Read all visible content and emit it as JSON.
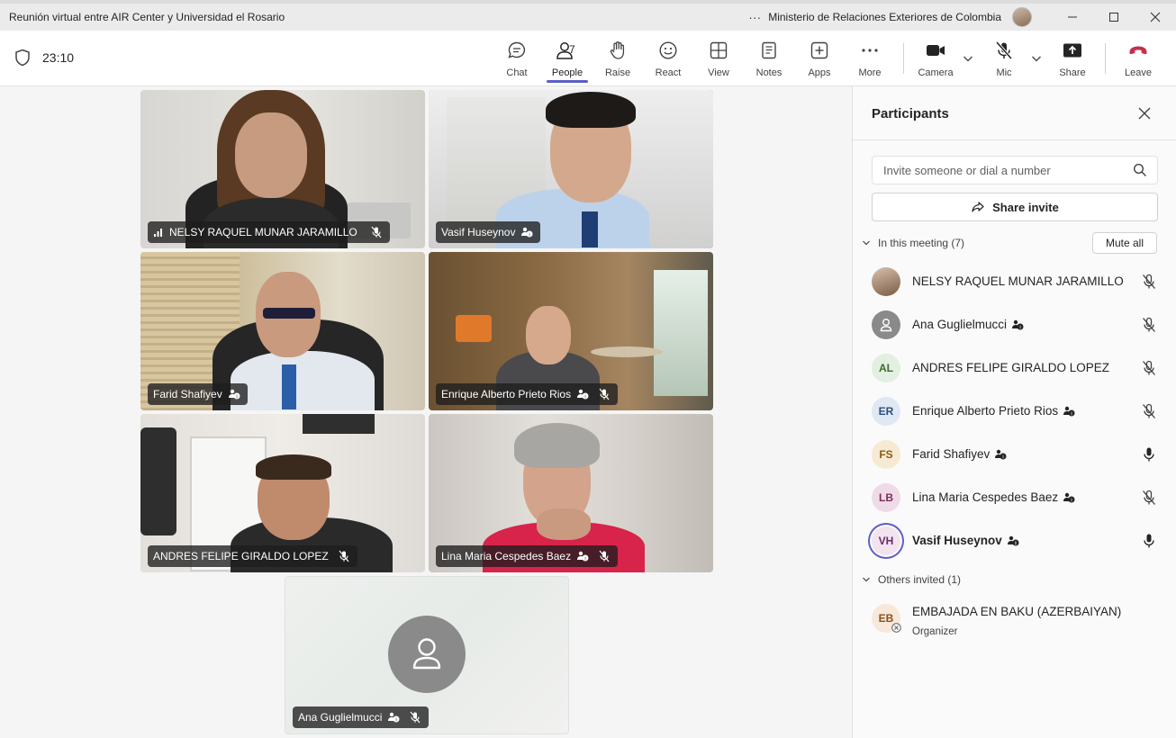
{
  "window": {
    "title": "Reunión virtual entre AIR Center y Universidad el Rosario",
    "more": "···",
    "organization": "Ministerio de Relaciones Exteriores de Colombia"
  },
  "toolbar": {
    "timer": "23:10",
    "people_count": "7",
    "items": {
      "chat": "Chat",
      "people": "People",
      "raise": "Raise",
      "react": "React",
      "view": "View",
      "notes": "Notes",
      "apps": "Apps",
      "more": "More",
      "camera": "Camera",
      "mic": "Mic",
      "share": "Share",
      "leave": "Leave"
    }
  },
  "stage": {
    "tiles": [
      {
        "name": "NELSY RAQUEL MUNAR JARAMILLO",
        "signal": true,
        "muted": true,
        "people_badge": false
      },
      {
        "name": "Vasif Huseynov",
        "muted": false,
        "people_badge": true,
        "speaking": true
      },
      {
        "name": "Farid Shafiyev",
        "muted": false,
        "people_badge": true
      },
      {
        "name": "Enrique Alberto Prieto Rios",
        "muted": true,
        "people_badge": true
      },
      {
        "name": "ANDRES FELIPE GIRALDO LOPEZ",
        "muted": true,
        "people_badge": false
      },
      {
        "name": "Lina Maria Cespedes Baez",
        "muted": true,
        "people_badge": true
      },
      {
        "name": "Ana Guglielmucci",
        "muted": true,
        "people_badge": true
      }
    ]
  },
  "panel": {
    "title": "Participants",
    "invite_placeholder": "Invite someone or dial a number",
    "share_invite": "Share invite",
    "in_meeting_label": "In this meeting (7)",
    "mute_all": "Mute all",
    "participants": [
      {
        "name": "NELSY RAQUEL MUNAR JARAMILLO",
        "initials": "",
        "photo": true,
        "mic": "muted",
        "badge": false
      },
      {
        "name": "Ana Guglielmucci",
        "initials": "",
        "generic": true,
        "mic": "muted",
        "badge": true
      },
      {
        "name": "ANDRES FELIPE GIRALDO LOPEZ",
        "initials": "AL",
        "mic": "muted",
        "badge": false,
        "bg": "#e3efe0",
        "fg": "#3b6b2f"
      },
      {
        "name": "Enrique Alberto Prieto Rios",
        "initials": "ER",
        "mic": "muted",
        "badge": true,
        "bg": "#dfe8f3",
        "fg": "#2d4f7c"
      },
      {
        "name": "Farid Shafiyev",
        "initials": "FS",
        "mic": "on",
        "badge": true,
        "bg": "#f7ead2",
        "fg": "#8a5b14"
      },
      {
        "name": "Lina Maria Cespedes Baez",
        "initials": "LB",
        "mic": "muted",
        "badge": true,
        "bg": "#efdbe8",
        "fg": "#7b2d5e"
      },
      {
        "name": "Vasif Huseynov",
        "initials": "VH",
        "mic": "on",
        "badge": true,
        "bold": true,
        "bg": "#f2e3ef",
        "fg": "#6b2a63"
      }
    ],
    "others_label": "Others invited (1)",
    "others": [
      {
        "name": "EMBAJADA EN BAKU (AZERBAIYAN)",
        "initials": "EB",
        "sub": "Organizer",
        "bg": "#f7e8da",
        "fg": "#8a4f1c"
      }
    ]
  },
  "colors": {
    "accent": "#5b5fc7",
    "leave": "#c4314b"
  }
}
